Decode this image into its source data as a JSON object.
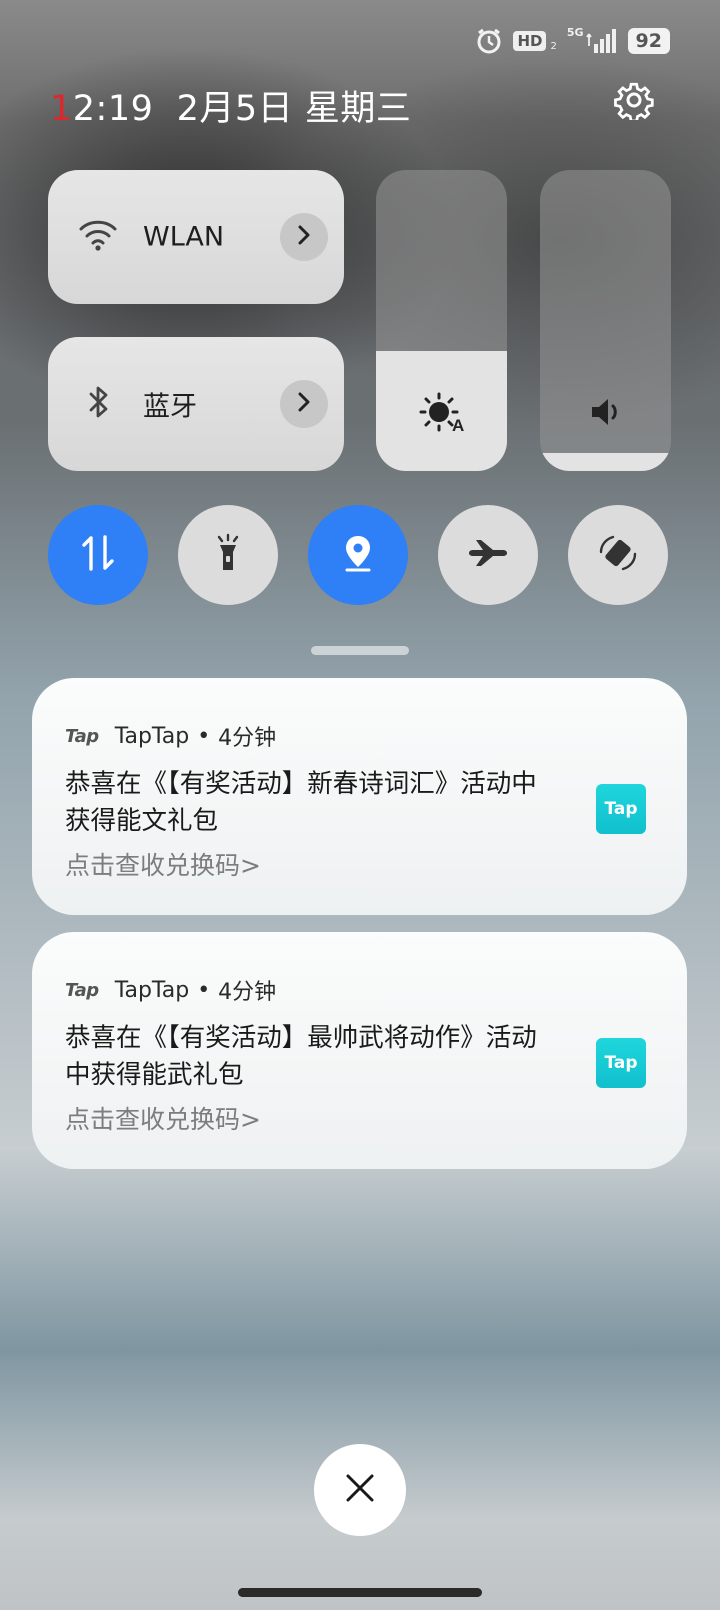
{
  "status_bar": {
    "alarm_icon": "alarm-clock-icon",
    "hd_label": "HD",
    "hd_sub": "2",
    "network_label": "5G",
    "signal_icon": "signal-bars-icon",
    "battery": "92"
  },
  "header": {
    "time_first_digit": "1",
    "time_rest": "2:19",
    "date": "2月5日 星期三",
    "settings_icon": "gear-icon"
  },
  "tiles": {
    "wlan": {
      "label": "WLAN",
      "icon": "wifi-icon"
    },
    "bluetooth": {
      "label": "蓝牙",
      "icon": "bluetooth-icon"
    }
  },
  "sliders": {
    "brightness": {
      "icon": "auto-brightness-icon",
      "level": 0.4
    },
    "volume": {
      "icon": "speaker-icon",
      "level": 0.06
    }
  },
  "toggles": [
    {
      "name": "mobile-data",
      "icon": "data-arrows-icon",
      "active": true
    },
    {
      "name": "flashlight",
      "icon": "flashlight-icon",
      "active": false
    },
    {
      "name": "location",
      "icon": "location-pin-icon",
      "active": true
    },
    {
      "name": "airplane-mode",
      "icon": "airplane-icon",
      "active": false
    },
    {
      "name": "auto-rotate",
      "icon": "rotate-icon",
      "active": false
    }
  ],
  "notifications": [
    {
      "app_logo": "Tap",
      "app": "TapTap",
      "sep": "•",
      "time": "4分钟",
      "title": "恭喜在《【有奖活动】新春诗词汇》活动中获得能文礼包",
      "subtitle": "点击查收兑换码>",
      "thumb": "Tap"
    },
    {
      "app_logo": "Tap",
      "app": "TapTap",
      "sep": "•",
      "time": "4分钟",
      "title": "恭喜在《【有奖活动】最帅武将动作》活动中获得能武礼包",
      "subtitle": "点击查收兑换码>",
      "thumb": "Tap"
    }
  ],
  "colors": {
    "accent": "#2f7ff7",
    "clock_red": "#e0262d",
    "tap_cyan": "#15cbd4"
  },
  "close_icon": "close-x-icon"
}
